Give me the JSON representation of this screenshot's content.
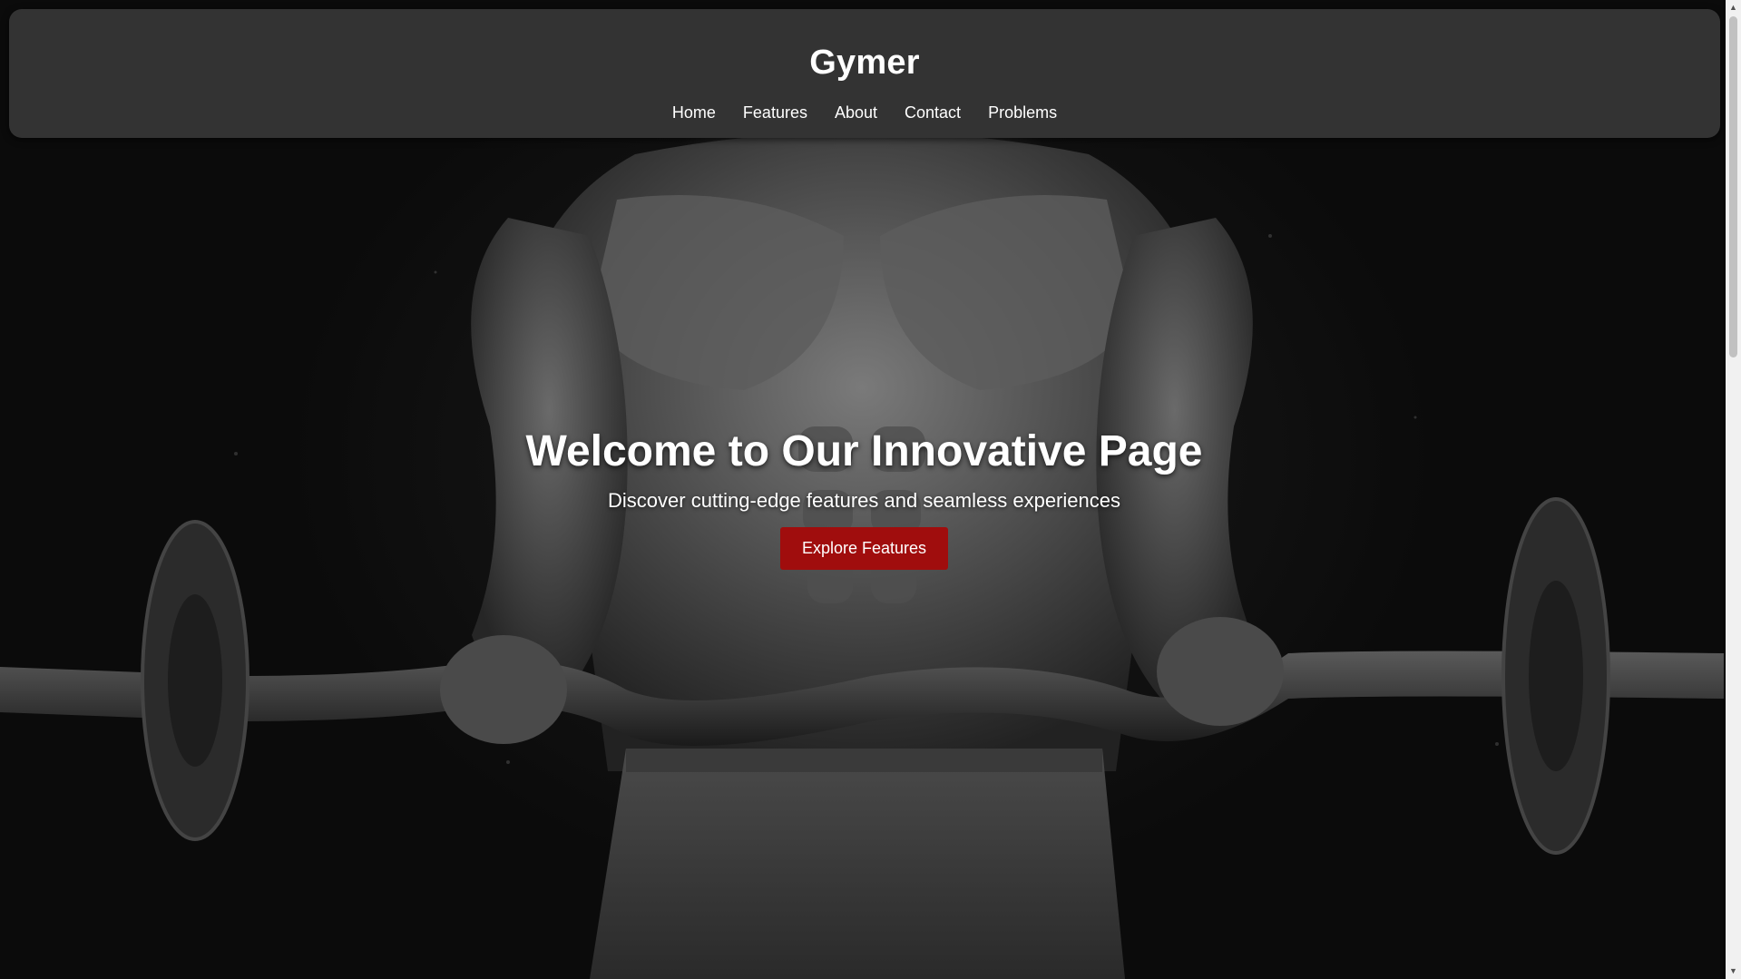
{
  "header": {
    "brand": "Gymer",
    "nav": [
      "Home",
      "Features",
      "About",
      "Contact",
      "Problems"
    ]
  },
  "hero": {
    "title": "Welcome to Our Innovative Page",
    "subtitle": "Discover cutting-edge features and seamless experiences",
    "cta_label": "Explore Features"
  },
  "colors": {
    "header_bg": "#333333",
    "cta_bg": "#a00d0d",
    "text": "#ffffff",
    "page_bg": "#080808"
  },
  "scrollbar": {
    "position_fraction": 0.0
  }
}
